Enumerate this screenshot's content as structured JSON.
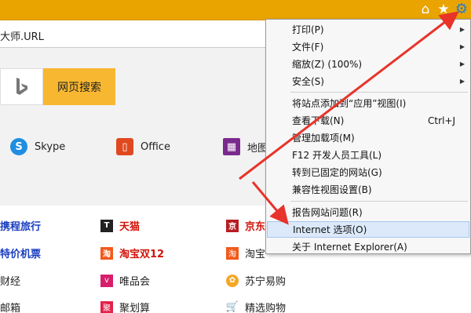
{
  "address": {
    "url_tail": "大师.URL"
  },
  "search": {
    "button_label": "网页搜索"
  },
  "quick_links": [
    {
      "label": "Skype"
    },
    {
      "label": "Office"
    },
    {
      "label": "地图"
    }
  ],
  "content": {
    "col1": [
      "携程旅行",
      "特价机票",
      "财经",
      "邮箱"
    ],
    "col2": [
      "天猫",
      "淘宝双12",
      "唯品会",
      "聚划算"
    ],
    "col3": [
      "京东",
      "淘宝",
      "苏宁易购",
      "精选购物"
    ]
  },
  "menu": {
    "items": [
      {
        "label": "打印(P)",
        "submenu": true
      },
      {
        "label": "文件(F)",
        "submenu": true
      },
      {
        "label": "缩放(Z) (100%)",
        "submenu": true
      },
      {
        "label": "安全(S)",
        "submenu": true
      },
      {
        "label": "将站点添加到“应用”视图(I)"
      },
      {
        "label": "查看下载(N)",
        "shortcut": "Ctrl+J"
      },
      {
        "label": "管理加载项(M)"
      },
      {
        "label": "F12 开发人员工具(L)"
      },
      {
        "label": "转到已固定的网站(G)"
      },
      {
        "label": "兼容性视图设置(B)"
      },
      {
        "label": "报告网站问题(R)"
      },
      {
        "label": "Internet 选项(O)",
        "highlighted": true
      },
      {
        "label": "关于 Internet Explorer(A)"
      }
    ]
  },
  "colors": {
    "toolbar": "#e9a400",
    "search_button": "#f7b730",
    "arrow": "#e8332a",
    "menu_highlight": "#dbe9fa"
  }
}
